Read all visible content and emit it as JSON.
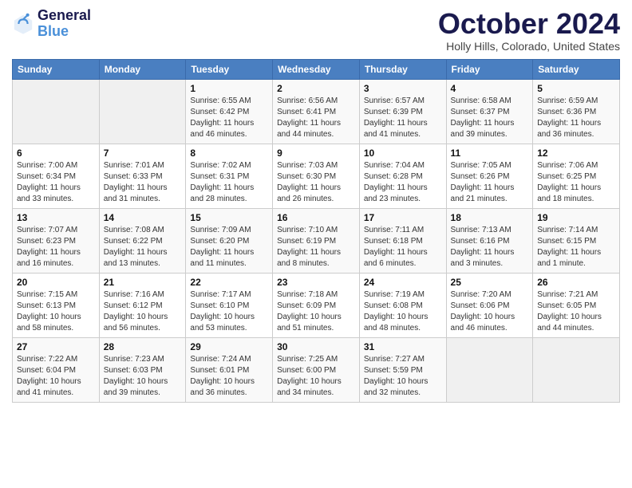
{
  "header": {
    "logo_line1": "General",
    "logo_line2": "Blue",
    "month": "October 2024",
    "location": "Holly Hills, Colorado, United States"
  },
  "weekdays": [
    "Sunday",
    "Monday",
    "Tuesday",
    "Wednesday",
    "Thursday",
    "Friday",
    "Saturday"
  ],
  "weeks": [
    [
      {
        "day": "",
        "sunrise": "",
        "sunset": "",
        "daylight": ""
      },
      {
        "day": "",
        "sunrise": "",
        "sunset": "",
        "daylight": ""
      },
      {
        "day": "1",
        "sunrise": "Sunrise: 6:55 AM",
        "sunset": "Sunset: 6:42 PM",
        "daylight": "Daylight: 11 hours and 46 minutes."
      },
      {
        "day": "2",
        "sunrise": "Sunrise: 6:56 AM",
        "sunset": "Sunset: 6:41 PM",
        "daylight": "Daylight: 11 hours and 44 minutes."
      },
      {
        "day": "3",
        "sunrise": "Sunrise: 6:57 AM",
        "sunset": "Sunset: 6:39 PM",
        "daylight": "Daylight: 11 hours and 41 minutes."
      },
      {
        "day": "4",
        "sunrise": "Sunrise: 6:58 AM",
        "sunset": "Sunset: 6:37 PM",
        "daylight": "Daylight: 11 hours and 39 minutes."
      },
      {
        "day": "5",
        "sunrise": "Sunrise: 6:59 AM",
        "sunset": "Sunset: 6:36 PM",
        "daylight": "Daylight: 11 hours and 36 minutes."
      }
    ],
    [
      {
        "day": "6",
        "sunrise": "Sunrise: 7:00 AM",
        "sunset": "Sunset: 6:34 PM",
        "daylight": "Daylight: 11 hours and 33 minutes."
      },
      {
        "day": "7",
        "sunrise": "Sunrise: 7:01 AM",
        "sunset": "Sunset: 6:33 PM",
        "daylight": "Daylight: 11 hours and 31 minutes."
      },
      {
        "day": "8",
        "sunrise": "Sunrise: 7:02 AM",
        "sunset": "Sunset: 6:31 PM",
        "daylight": "Daylight: 11 hours and 28 minutes."
      },
      {
        "day": "9",
        "sunrise": "Sunrise: 7:03 AM",
        "sunset": "Sunset: 6:30 PM",
        "daylight": "Daylight: 11 hours and 26 minutes."
      },
      {
        "day": "10",
        "sunrise": "Sunrise: 7:04 AM",
        "sunset": "Sunset: 6:28 PM",
        "daylight": "Daylight: 11 hours and 23 minutes."
      },
      {
        "day": "11",
        "sunrise": "Sunrise: 7:05 AM",
        "sunset": "Sunset: 6:26 PM",
        "daylight": "Daylight: 11 hours and 21 minutes."
      },
      {
        "day": "12",
        "sunrise": "Sunrise: 7:06 AM",
        "sunset": "Sunset: 6:25 PM",
        "daylight": "Daylight: 11 hours and 18 minutes."
      }
    ],
    [
      {
        "day": "13",
        "sunrise": "Sunrise: 7:07 AM",
        "sunset": "Sunset: 6:23 PM",
        "daylight": "Daylight: 11 hours and 16 minutes."
      },
      {
        "day": "14",
        "sunrise": "Sunrise: 7:08 AM",
        "sunset": "Sunset: 6:22 PM",
        "daylight": "Daylight: 11 hours and 13 minutes."
      },
      {
        "day": "15",
        "sunrise": "Sunrise: 7:09 AM",
        "sunset": "Sunset: 6:20 PM",
        "daylight": "Daylight: 11 hours and 11 minutes."
      },
      {
        "day": "16",
        "sunrise": "Sunrise: 7:10 AM",
        "sunset": "Sunset: 6:19 PM",
        "daylight": "Daylight: 11 hours and 8 minutes."
      },
      {
        "day": "17",
        "sunrise": "Sunrise: 7:11 AM",
        "sunset": "Sunset: 6:18 PM",
        "daylight": "Daylight: 11 hours and 6 minutes."
      },
      {
        "day": "18",
        "sunrise": "Sunrise: 7:13 AM",
        "sunset": "Sunset: 6:16 PM",
        "daylight": "Daylight: 11 hours and 3 minutes."
      },
      {
        "day": "19",
        "sunrise": "Sunrise: 7:14 AM",
        "sunset": "Sunset: 6:15 PM",
        "daylight": "Daylight: 11 hours and 1 minute."
      }
    ],
    [
      {
        "day": "20",
        "sunrise": "Sunrise: 7:15 AM",
        "sunset": "Sunset: 6:13 PM",
        "daylight": "Daylight: 10 hours and 58 minutes."
      },
      {
        "day": "21",
        "sunrise": "Sunrise: 7:16 AM",
        "sunset": "Sunset: 6:12 PM",
        "daylight": "Daylight: 10 hours and 56 minutes."
      },
      {
        "day": "22",
        "sunrise": "Sunrise: 7:17 AM",
        "sunset": "Sunset: 6:10 PM",
        "daylight": "Daylight: 10 hours and 53 minutes."
      },
      {
        "day": "23",
        "sunrise": "Sunrise: 7:18 AM",
        "sunset": "Sunset: 6:09 PM",
        "daylight": "Daylight: 10 hours and 51 minutes."
      },
      {
        "day": "24",
        "sunrise": "Sunrise: 7:19 AM",
        "sunset": "Sunset: 6:08 PM",
        "daylight": "Daylight: 10 hours and 48 minutes."
      },
      {
        "day": "25",
        "sunrise": "Sunrise: 7:20 AM",
        "sunset": "Sunset: 6:06 PM",
        "daylight": "Daylight: 10 hours and 46 minutes."
      },
      {
        "day": "26",
        "sunrise": "Sunrise: 7:21 AM",
        "sunset": "Sunset: 6:05 PM",
        "daylight": "Daylight: 10 hours and 44 minutes."
      }
    ],
    [
      {
        "day": "27",
        "sunrise": "Sunrise: 7:22 AM",
        "sunset": "Sunset: 6:04 PM",
        "daylight": "Daylight: 10 hours and 41 minutes."
      },
      {
        "day": "28",
        "sunrise": "Sunrise: 7:23 AM",
        "sunset": "Sunset: 6:03 PM",
        "daylight": "Daylight: 10 hours and 39 minutes."
      },
      {
        "day": "29",
        "sunrise": "Sunrise: 7:24 AM",
        "sunset": "Sunset: 6:01 PM",
        "daylight": "Daylight: 10 hours and 36 minutes."
      },
      {
        "day": "30",
        "sunrise": "Sunrise: 7:25 AM",
        "sunset": "Sunset: 6:00 PM",
        "daylight": "Daylight: 10 hours and 34 minutes."
      },
      {
        "day": "31",
        "sunrise": "Sunrise: 7:27 AM",
        "sunset": "Sunset: 5:59 PM",
        "daylight": "Daylight: 10 hours and 32 minutes."
      },
      {
        "day": "",
        "sunrise": "",
        "sunset": "",
        "daylight": ""
      },
      {
        "day": "",
        "sunrise": "",
        "sunset": "",
        "daylight": ""
      }
    ]
  ]
}
